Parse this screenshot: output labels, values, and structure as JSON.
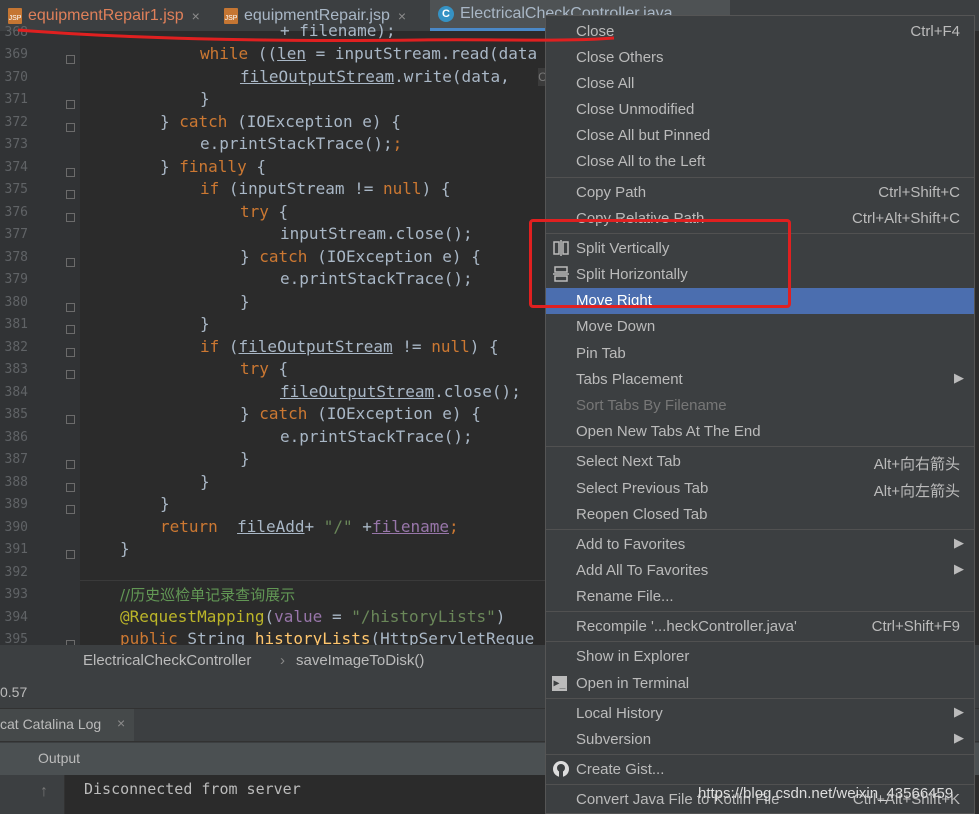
{
  "tabs": [
    {
      "label": "equipmentRepair1.jsp",
      "icon": "jsp-file-icon"
    },
    {
      "label": "equipmentRepair.jsp",
      "icon": "jsp-file-icon"
    },
    {
      "label": "ElectricalCheckController.java",
      "icon": "java-class-icon"
    }
  ],
  "jsp_icon_label": "JSP",
  "class_icon_label": "C",
  "close_glyph": "×",
  "line_numbers": [
    "368",
    "369",
    "370",
    "371",
    "372",
    "373",
    "374",
    "375",
    "376",
    "377",
    "378",
    "379",
    "380",
    "381",
    "382",
    "383",
    "384",
    "385",
    "386",
    "387",
    "388",
    "389",
    "390",
    "391",
    "392",
    "393",
    "394",
    "395"
  ],
  "code": {
    "l368": "+ filename);",
    "l369_kw": "while",
    "l369_a": " ((",
    "l369_len": "len",
    "l369_b": " = inputStream.read(data",
    "l369_hint": "C",
    "l370_var": "fileOutputStream",
    "l370_rest": ".write(data,",
    "l371": "}",
    "l372_a": "} ",
    "l372_kw": "catch",
    "l372_b": " (IOException e) {",
    "l373": "e.printStackTrace();",
    "l374_a": "} ",
    "l374_kw": "finally",
    "l374_b": " {",
    "l375_kw": "if",
    "l375_a": " (inputStream != ",
    "l375_null": "null",
    "l375_b": ") {",
    "l376_kw": "try",
    "l376_b": " {",
    "l377": "inputStream.close();",
    "l378_a": "} ",
    "l378_kw": "catch",
    "l378_b": " (IOException e) {",
    "l379": "e.printStackTrace();",
    "l380": "}",
    "l381": "}",
    "l382_kw": "if",
    "l382_a": " (",
    "l382_var": "fileOutputStream",
    "l382_b": " != ",
    "l382_null": "null",
    "l382_c": ") {",
    "l383_kw": "try",
    "l383_b": " {",
    "l384_var": "fileOutputStream",
    "l384_rest": ".close();",
    "l385_a": "} ",
    "l385_kw": "catch",
    "l385_b": " (IOException e) {",
    "l386": "e.printStackTrace();",
    "l387": "}",
    "l388": "}",
    "l389": "}",
    "l390_kw": "return",
    "l390_a": "  ",
    "l390_fa": "fileAdd",
    "l390_b": "+ ",
    "l390_str": "\"/\"",
    "l390_c": " +",
    "l390_fn": "filename",
    "l390_d": ";",
    "l391": "}",
    "l393": "//历史巡检单记录查询展示",
    "l394_ann": "@RequestMapping",
    "l394_a": "(",
    "l394_val": "value",
    "l394_b": " = ",
    "l394_str": "\"/historyLists\"",
    "l394_c": ")",
    "l395_kw": "public",
    "l395_a": " String ",
    "l395_m": "historyLists",
    "l395_b": "(HttpServletReque"
  },
  "breadcrumb": {
    "class": "ElectricalCheckController",
    "sep": "›",
    "method": "saveImageToDisk()"
  },
  "toolwindow": {
    "version": "0.57",
    "tab_label": "cat Catalina Log",
    "output_label": "Output",
    "up_arrow": "↑",
    "message": "Disconnected from server"
  },
  "menu": {
    "items": [
      {
        "label": "Close",
        "shortcut": "Ctrl+F4"
      },
      {
        "label": "Close Others"
      },
      {
        "label": "Close All"
      },
      {
        "label": "Close Unmodified"
      },
      {
        "label": "Close All but Pinned"
      },
      {
        "label": "Close All to the Left"
      },
      {
        "label": "Copy Path",
        "shortcut": "Ctrl+Shift+C"
      },
      {
        "label": "Copy Relative Path",
        "shortcut": "Ctrl+Alt+Shift+C"
      },
      {
        "label": "Split Vertically"
      },
      {
        "label": "Split Horizontally"
      },
      {
        "label": "Move Right"
      },
      {
        "label": "Move Down"
      },
      {
        "label": "Pin Tab"
      },
      {
        "label": "Tabs Placement"
      },
      {
        "label": "Sort Tabs By Filename"
      },
      {
        "label": "Open New Tabs At The End"
      },
      {
        "label": "Select Next Tab",
        "shortcut": "Alt+向右箭头"
      },
      {
        "label": "Select Previous Tab",
        "shortcut": "Alt+向左箭头"
      },
      {
        "label": "Reopen Closed Tab"
      },
      {
        "label": "Add to Favorites"
      },
      {
        "label": "Add All To Favorites"
      },
      {
        "label": "Rename File..."
      },
      {
        "label": "Recompile '...heckController.java'",
        "shortcut": "Ctrl+Shift+F9"
      },
      {
        "label": "Show in Explorer"
      },
      {
        "label": "Open in Terminal"
      },
      {
        "label": "Local History"
      },
      {
        "label": "Subversion"
      },
      {
        "label": "Create Gist..."
      },
      {
        "label": "Convert Java File to Kotlin File",
        "shortcut": "Ctrl+Alt+Shift+K"
      }
    ],
    "submenu_arrow": "▶",
    "terminal_glyph": "▶_"
  },
  "watermark": "https://blog.csdn.net/weixin_43566459",
  "colors": {
    "accent": "#4b6eaf",
    "annotation_red": "#e02020",
    "keyword": "#cc7832",
    "string": "#6a8759"
  }
}
